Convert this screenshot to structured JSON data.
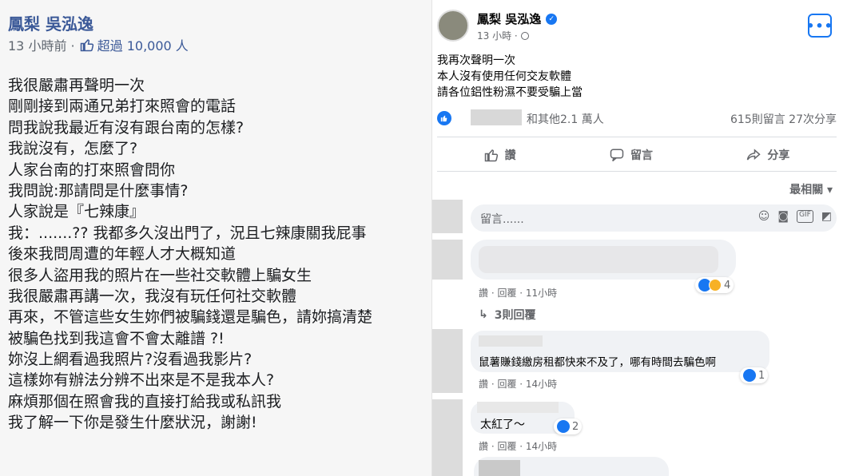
{
  "left": {
    "name": "鳳梨 吳泓逸",
    "time": "13 小時前 ·",
    "likes": "超過 10,000 人",
    "lines": [
      "我很嚴肅再聲明一次",
      "剛剛接到兩通兄弟打來照會的電話",
      "問我說我最近有沒有跟台南的怎樣?",
      "我說沒有，怎麼了?",
      "人家台南的打來照會問你",
      "我問說:那請問是什麼事情?",
      "人家說是『七辣康』",
      "我：.......?? 我都多久沒出門了，況且七辣康關我屁事",
      "後來我問周遭的年輕人才大概知道",
      "很多人盜用我的照片在一些社交軟體上騙女生",
      "我很嚴肅再講一次，我沒有玩任何社交軟體",
      "再來，不管這些女生妳們被騙錢還是騙色，請妳搞清楚",
      "被騙色找到我這會不會太離譜 ?!",
      "妳沒上網看過我照片?沒看過我影片?",
      "這樣妳有辦法分辨不出來是不是我本人?",
      "麻煩那個在照會我的直接打給我或私訊我",
      "我了解一下你是發生什麼狀況，謝謝!"
    ]
  },
  "right": {
    "name": "鳳梨 吳泓逸",
    "time": "13 小時 ·",
    "post_lines": [
      "我再次聲明一次",
      "本人沒有使用任何交友軟體",
      "請各位鋁性粉濕不要受騙上當"
    ],
    "reaction_text": "和其他2.1 萬人",
    "counts": "615則留言  27次分享",
    "actions": {
      "like": "讚",
      "comment": "留言",
      "share": "分享"
    },
    "sort": "最相關",
    "input_placeholder": "留言......",
    "comments": [
      {
        "meta": "讚 · 回覆 · 11小時",
        "react_count": "4"
      },
      {
        "text": "鼠薯賺錢繳房租都快來不及了，哪有時間去騙色啊",
        "meta": "讚 · 回覆 · 14小時",
        "react_count": "1"
      },
      {
        "text": "太紅了～",
        "meta": "讚 · 回覆 · 14小時",
        "react_count": "2"
      }
    ],
    "replies": "3則回覆"
  }
}
